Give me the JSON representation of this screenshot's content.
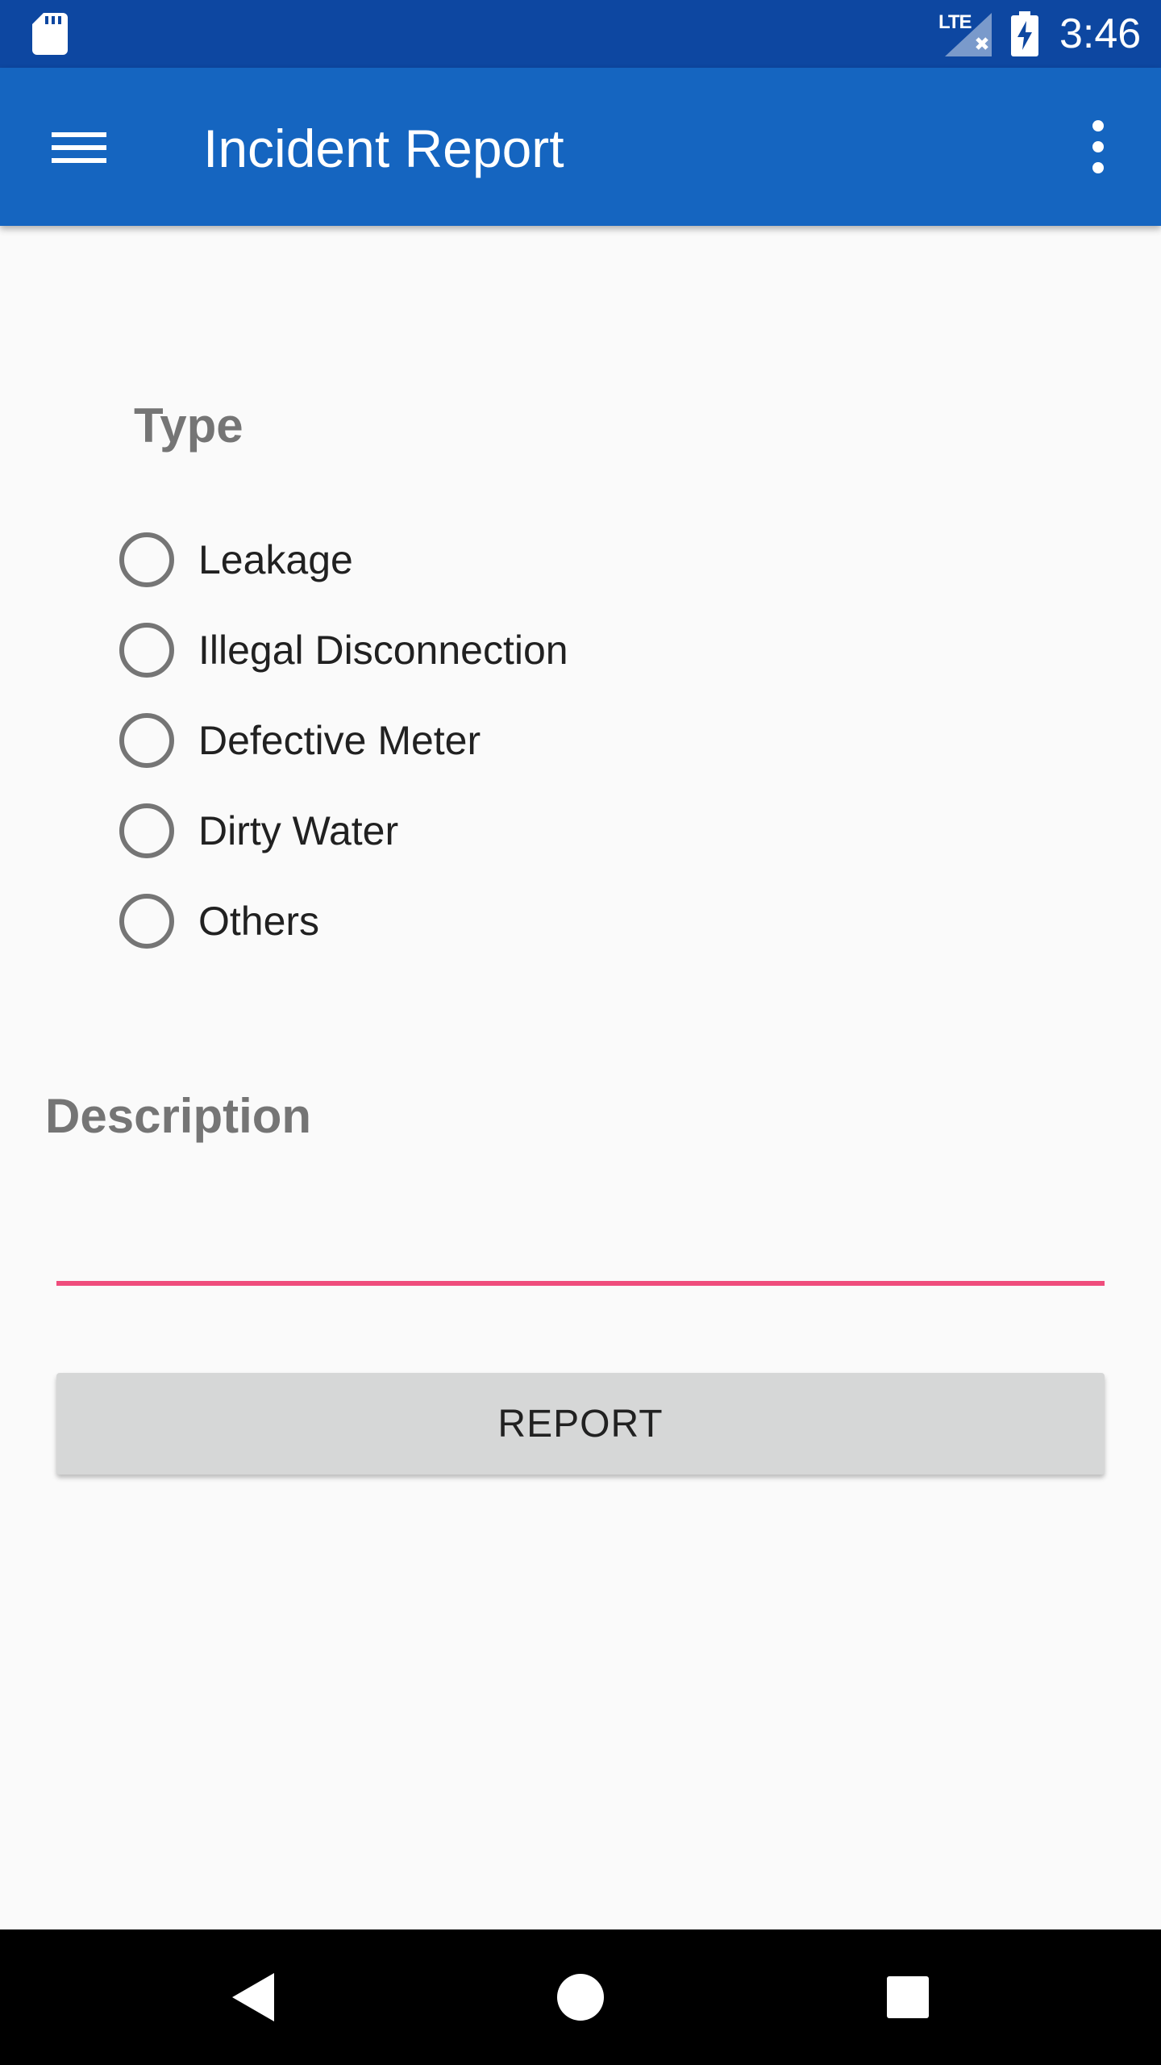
{
  "status_bar": {
    "network_label": "LTE",
    "time": "3:46",
    "icons": [
      "sd-card-icon",
      "signal-no-data-icon",
      "battery-charging-icon"
    ]
  },
  "app_bar": {
    "title": "Incident Report",
    "icons": [
      "menu-icon",
      "overflow-icon"
    ]
  },
  "form": {
    "type_label": "Type",
    "options": [
      {
        "label": "Leakage",
        "selected": false
      },
      {
        "label": "Illegal Disconnection",
        "selected": false
      },
      {
        "label": "Defective Meter",
        "selected": false
      },
      {
        "label": "Dirty Water",
        "selected": false
      },
      {
        "label": "Others",
        "selected": false
      }
    ],
    "description_label": "Description",
    "description_value": "",
    "submit_label": "REPORT"
  },
  "nav_bar": {
    "icons": [
      "back-icon",
      "home-icon",
      "recents-icon"
    ]
  },
  "colors": {
    "status_bar": "#0d47a1",
    "app_bar": "#1565c0",
    "input_underline": "#ef4d7c",
    "button_bg": "#d6d7d7",
    "label_grey": "#757575"
  }
}
